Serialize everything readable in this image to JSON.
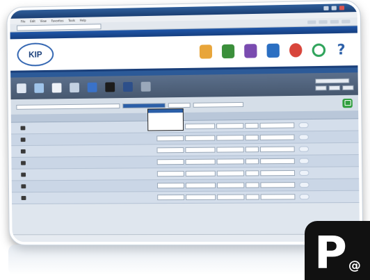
{
  "browser": {
    "title": "",
    "menu": [
      "File",
      "Edit",
      "View",
      "Favorites",
      "Tools",
      "Help"
    ],
    "address": ""
  },
  "app": {
    "logo_text": "KIP",
    "header_icons": [
      {
        "icon": "bottle-icon",
        "color": "#e8a53a"
      },
      {
        "icon": "globe-icon",
        "color": "#3b8f3b"
      },
      {
        "icon": "edit-pen-icon",
        "color": "#7a4bb0"
      },
      {
        "icon": "printer-icon",
        "color": "#2b6fc2"
      },
      {
        "icon": "color-wheel-icon",
        "color": "#d8453b"
      },
      {
        "icon": "refresh-icon",
        "color": "#2ea35a"
      },
      {
        "icon": "help-icon",
        "color": "#2b5fa8"
      }
    ],
    "toolbar_tools": [
      {
        "icon": "document-icon",
        "color": "#dfe7f2"
      },
      {
        "icon": "copy-icon",
        "color": "#9fc4ea"
      },
      {
        "icon": "page-icon",
        "color": "#eef2f8"
      },
      {
        "icon": "scan-icon",
        "color": "#c3d1e2"
      },
      {
        "icon": "save-icon",
        "color": "#3a72c8"
      },
      {
        "icon": "pencil-icon",
        "color": "#1c1c1c"
      },
      {
        "icon": "stamp-icon",
        "color": "#2d4f8a"
      },
      {
        "icon": "tool-icon",
        "color": "#9aa8ba"
      }
    ],
    "dropdown_options": [
      "",
      "",
      "",
      "",
      "",
      ""
    ],
    "rows": [
      {
        "name": ""
      },
      {
        "name": ""
      },
      {
        "name": ""
      },
      {
        "name": ""
      },
      {
        "name": ""
      },
      {
        "name": ""
      },
      {
        "name": ""
      }
    ],
    "accent": "#1a3f7a",
    "go_color": "#2f9e3d"
  },
  "badge": {
    "letter": "P",
    "suffix": "@"
  }
}
